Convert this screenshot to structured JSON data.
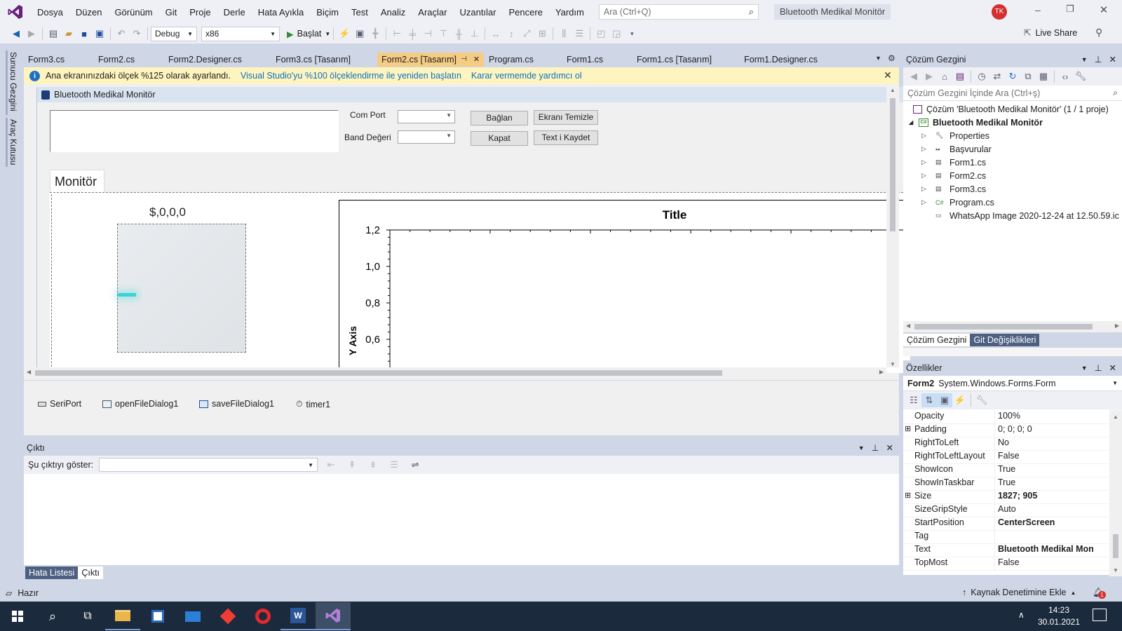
{
  "title_bar": {
    "menu": [
      "Dosya",
      "Düzen",
      "Görünüm",
      "Git",
      "Proje",
      "Derle",
      "Hata Ayıkla",
      "Biçim",
      "Test",
      "Analiz",
      "Araçlar",
      "Uzantılar",
      "Pencere",
      "Yardım"
    ],
    "search_placeholder": "Ara (Ctrl+Q)",
    "solution_name": "Bluetooth Medikal Monitör",
    "user_initials": "TK"
  },
  "toolbar": {
    "config": "Debug",
    "platform": "x86",
    "start_label": "Başlat",
    "live_share": "Live Share"
  },
  "editor_tabs": [
    {
      "label": "Form3.cs",
      "active": false
    },
    {
      "label": "Form2.cs",
      "active": false
    },
    {
      "label": "Form2.Designer.cs",
      "active": false
    },
    {
      "label": "Form3.cs [Tasarım]",
      "active": false
    },
    {
      "label": "Form2.cs [Tasarım]",
      "active": true
    },
    {
      "label": "Program.cs",
      "active": false
    },
    {
      "label": "Form1.cs",
      "active": false
    },
    {
      "label": "Form1.cs [Tasarım]",
      "active": false
    },
    {
      "label": "Form1.Designer.cs",
      "active": false
    }
  ],
  "info_bar": {
    "message": "Ana ekranınızdaki ölçek %125 olarak ayarlandı.",
    "link1": "Visual Studio'yu %100 ölçeklendirme ile yeniden başlatın",
    "link2": "Karar vermemde yardımcı ol"
  },
  "designer": {
    "form_title": "Bluetooth Medikal Monitör",
    "com_port_label": "Com Port",
    "baud_label": "Band Değeri",
    "btn_connect": "Bağlan",
    "btn_clear": "Ekranı Temizle",
    "btn_close": "Kapat",
    "btn_save": "Text i Kaydet",
    "group_label": "Monitör",
    "gauge_label": "$,0,0,0",
    "components": [
      "SeriPort",
      "openFileDialog1",
      "saveFileDialog1",
      "timer1"
    ]
  },
  "chart_data": {
    "type": "line",
    "title": "Title",
    "ylabel": "Y Axis",
    "yticks": [
      "1,2",
      "1,0",
      "0,8",
      "0,6"
    ],
    "series": []
  },
  "output_panel": {
    "title": "Çıktı",
    "show_label": "Şu çıktıyı göster:",
    "bottom_tabs": [
      "Hata Listesi",
      "Çıktı"
    ]
  },
  "side_tabs": [
    "Sunucu Gezgini",
    "Araç Kutusu"
  ],
  "solution_explorer": {
    "title": "Çözüm Gezgini",
    "search_placeholder": "Çözüm Gezgini İçinde Ara (Ctrl+ş)",
    "solution": "Çözüm 'Bluetooth Medikal Monitör' (1 / 1 proje)",
    "project": "Bluetooth Medikal Monitör",
    "items": [
      "Properties",
      "Başvurular",
      "Form1.cs",
      "Form2.cs",
      "Form3.cs",
      "Program.cs",
      "WhatsApp Image 2020-12-24 at 12.50.59.ic"
    ],
    "bottom_tabs": [
      "Çözüm Gezgini",
      "Git Değişiklikleri"
    ]
  },
  "properties": {
    "title": "Özellikler",
    "object_name": "Form2",
    "object_type": "System.Windows.Forms.Form",
    "rows": [
      {
        "name": "Opacity",
        "value": "100%",
        "bold": false,
        "expand": false
      },
      {
        "name": "Padding",
        "value": "0; 0; 0; 0",
        "bold": false,
        "expand": true
      },
      {
        "name": "RightToLeft",
        "value": "No",
        "bold": false,
        "expand": false
      },
      {
        "name": "RightToLeftLayout",
        "value": "False",
        "bold": false,
        "expand": false
      },
      {
        "name": "ShowIcon",
        "value": "True",
        "bold": false,
        "expand": false
      },
      {
        "name": "ShowInTaskbar",
        "value": "True",
        "bold": false,
        "expand": false
      },
      {
        "name": "Size",
        "value": "1827; 905",
        "bold": true,
        "expand": true
      },
      {
        "name": "SizeGripStyle",
        "value": "Auto",
        "bold": false,
        "expand": false
      },
      {
        "name": "StartPosition",
        "value": "CenterScreen",
        "bold": true,
        "expand": false
      },
      {
        "name": "Tag",
        "value": "",
        "bold": false,
        "expand": false
      },
      {
        "name": "Text",
        "value": "Bluetooth Medikal Mon",
        "bold": true,
        "expand": false
      },
      {
        "name": "TopMost",
        "value": "False",
        "bold": false,
        "expand": false
      }
    ]
  },
  "status_bar": {
    "status": "Hazır",
    "source_control": "Kaynak Denetimine Ekle",
    "notification_count": "1"
  },
  "taskbar": {
    "time": "14:23",
    "date": "30.01.2021"
  },
  "colors": {
    "accent": "#68217a",
    "chrome": "#eef0f5",
    "frame": "#cfd6e5",
    "active_tab": "#f5cc84",
    "info_bar": "#fdf4bf",
    "link": "#0e70c0"
  }
}
